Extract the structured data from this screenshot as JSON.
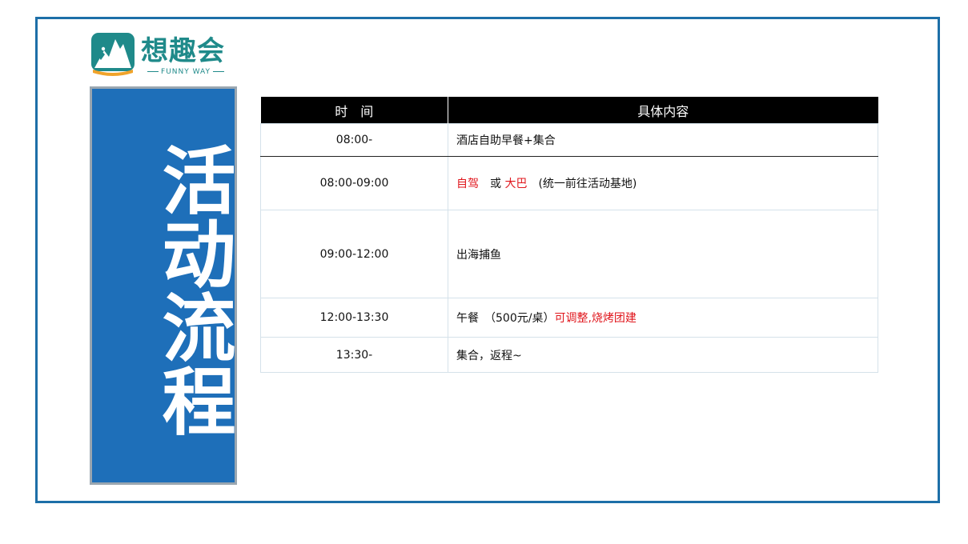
{
  "logo": {
    "name": "想趣会",
    "tagline": "FUNNY WAY",
    "brand_color": "#1f8a8a",
    "accent_color": "#f0a32a"
  },
  "title_panel": {
    "text": "活动流程",
    "background": "#1e6fb9"
  },
  "schedule": {
    "headers": [
      "时　间",
      "具体内容"
    ],
    "rows": [
      {
        "time": "08:00-",
        "content": [
          {
            "text": "酒店自助早餐+集合",
            "red": false
          }
        ]
      },
      {
        "time": "08:00-09:00",
        "content": [
          {
            "text": "自驾",
            "red": true
          },
          {
            "text": "　或 ",
            "red": false
          },
          {
            "text": "大巴",
            "red": true
          },
          {
            "text": "　(统一前往活动基地)",
            "red": false
          }
        ]
      },
      {
        "time": "09:00-12:00",
        "content": [
          {
            "text": "出海捕鱼",
            "red": false
          }
        ]
      },
      {
        "time": "12:00-13:30",
        "content": [
          {
            "text": "午餐　（500元/桌）",
            "red": false
          },
          {
            "text": "可调整,烧烤团建",
            "red": true
          }
        ]
      },
      {
        "time": "13:30-",
        "content": [
          {
            "text": "集合，返程~",
            "red": false
          }
        ]
      }
    ]
  },
  "colors": {
    "frame_border": "#1d6fa8",
    "header_bg": "#000000",
    "highlight_red": "#e0161c"
  }
}
